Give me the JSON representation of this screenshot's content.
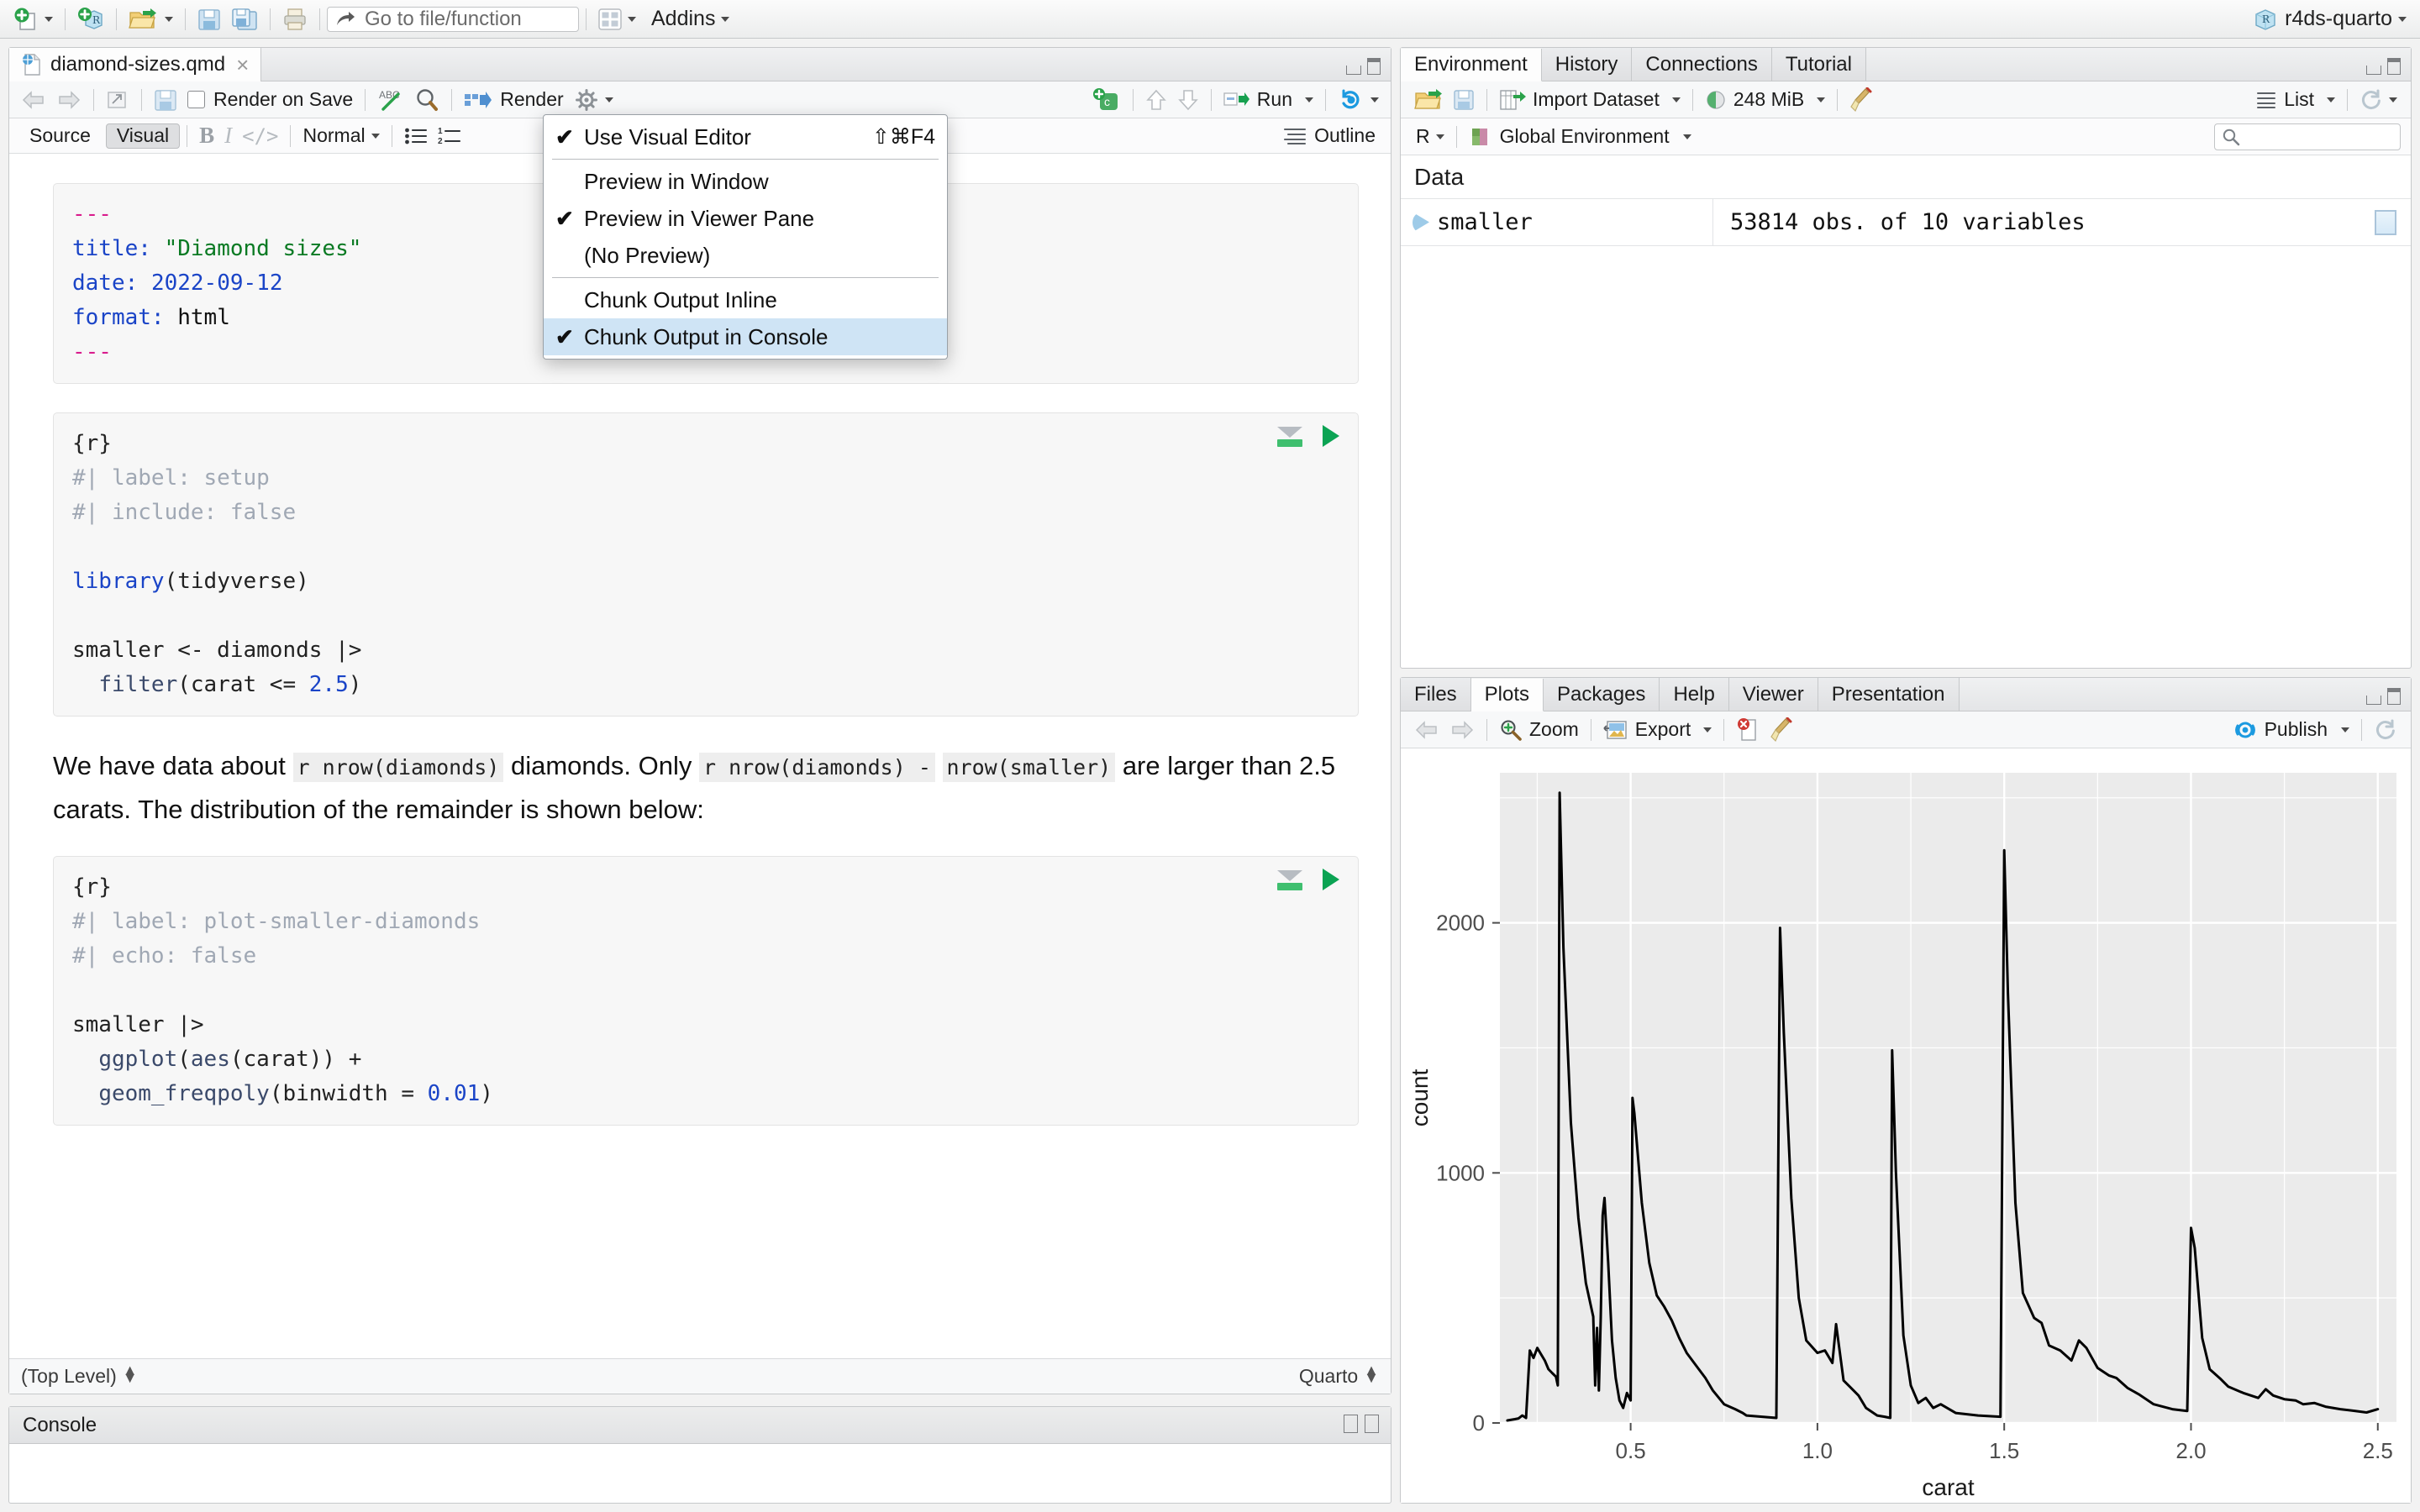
{
  "app": {
    "project_name": "r4ds-quarto",
    "goto_placeholder": "Go to file/function",
    "addins_label": "Addins"
  },
  "source_pane": {
    "tab_name": "diamond-sizes.qmd",
    "render_on_save_label": "Render on Save",
    "render_label": "Render",
    "run_label": "Run",
    "outline_label": "Outline",
    "mode_source": "Source",
    "mode_visual": "Visual",
    "block_format": "Normal",
    "status_left": "(Top Level)",
    "status_right": "Quarto"
  },
  "gear_menu": {
    "items": [
      {
        "label": "Use Visual Editor",
        "checked": true,
        "accel": "⇧⌘F4",
        "selected": false
      },
      {
        "label": "Preview in Window",
        "checked": false,
        "accel": "",
        "selected": false
      },
      {
        "label": "Preview in Viewer Pane",
        "checked": true,
        "accel": "",
        "selected": false
      },
      {
        "label": "(No Preview)",
        "checked": false,
        "accel": "",
        "selected": false
      },
      {
        "label": "Chunk Output Inline",
        "checked": false,
        "accel": "",
        "selected": false
      },
      {
        "label": "Chunk Output in Console",
        "checked": true,
        "accel": "",
        "selected": true
      }
    ],
    "separators_after": [
      0,
      3
    ]
  },
  "document": {
    "yaml": {
      "open_fence": "---",
      "close_fence": "---",
      "lines": [
        {
          "key": "title:",
          "value": "\"Diamond sizes\"",
          "kind": "string"
        },
        {
          "key": "date:",
          "value": "2022-09-12",
          "kind": "number"
        },
        {
          "key": "format:",
          "value": "html",
          "kind": "plain"
        }
      ]
    },
    "chunk1": {
      "header": "{r}",
      "options": [
        "#| label: setup",
        "#| include: false"
      ],
      "code_lines": [
        "library(tidyverse)",
        "",
        "smaller <- diamonds |>",
        "  filter(carat <= 2.5)"
      ]
    },
    "paragraph": {
      "seg1": "We have data about ",
      "code1": "r nrow(diamonds)",
      "seg2": " diamonds. Only ",
      "code2": "r nrow(diamonds) -",
      "code3": "nrow(smaller)",
      "seg3": " are larger than 2.5 carats. The distribution of the remainder is shown below:"
    },
    "chunk2": {
      "header": "{r}",
      "options": [
        "#| label: plot-smaller-diamonds",
        "#| echo: false"
      ],
      "code_lines": [
        "smaller |>",
        "  ggplot(aes(carat)) +",
        "  geom_freqpoly(binwidth = 0.01)"
      ]
    }
  },
  "environment_pane": {
    "tabs": [
      "Environment",
      "History",
      "Connections",
      "Tutorial"
    ],
    "active_tab": "Environment",
    "import_label": "Import Dataset",
    "memory_label": "248 MiB",
    "view_label": "List",
    "language": "R",
    "scope": "Global Environment",
    "search_placeholder": "",
    "section_title": "Data",
    "rows": [
      {
        "name": "smaller",
        "description": "53814 obs. of 10 variables"
      }
    ]
  },
  "plot_pane": {
    "tabs": [
      "Files",
      "Plots",
      "Packages",
      "Help",
      "Viewer",
      "Presentation"
    ],
    "active_tab": "Plots",
    "zoom_label": "Zoom",
    "export_label": "Export",
    "publish_label": "Publish"
  },
  "console_pane": {
    "title": "Console"
  },
  "chart_data": {
    "type": "line",
    "title": "",
    "xlabel": "carat",
    "ylabel": "count",
    "xlim": [
      0.15,
      2.55
    ],
    "ylim": [
      0,
      2600
    ],
    "xticks": [
      "0.5",
      "1.0",
      "1.5",
      "2.0",
      "2.5"
    ],
    "xtick_values": [
      0.5,
      1.0,
      1.5,
      2.0,
      2.5
    ],
    "yticks": [
      "0",
      "1000",
      "2000"
    ],
    "ytick_values": [
      0,
      1000,
      2000
    ],
    "grid": true,
    "panel_background": "#EBEBEB",
    "line_color": "#000000",
    "binwidth": 0.01,
    "series": [
      {
        "name": "count",
        "points": [
          [
            0.17,
            10
          ],
          [
            0.19,
            15
          ],
          [
            0.2,
            18
          ],
          [
            0.21,
            30
          ],
          [
            0.22,
            20
          ],
          [
            0.23,
            290
          ],
          [
            0.24,
            260
          ],
          [
            0.25,
            300
          ],
          [
            0.26,
            275
          ],
          [
            0.27,
            250
          ],
          [
            0.28,
            215
          ],
          [
            0.29,
            200
          ],
          [
            0.3,
            185
          ],
          [
            0.305,
            150
          ],
          [
            0.31,
            2520
          ],
          [
            0.32,
            1900
          ],
          [
            0.34,
            1200
          ],
          [
            0.36,
            820
          ],
          [
            0.38,
            560
          ],
          [
            0.4,
            425
          ],
          [
            0.405,
            150
          ],
          [
            0.41,
            380
          ],
          [
            0.415,
            130
          ],
          [
            0.42,
            420
          ],
          [
            0.425,
            830
          ],
          [
            0.43,
            900
          ],
          [
            0.44,
            640
          ],
          [
            0.45,
            330
          ],
          [
            0.46,
            180
          ],
          [
            0.47,
            90
          ],
          [
            0.48,
            60
          ],
          [
            0.49,
            120
          ],
          [
            0.5,
            90
          ],
          [
            0.505,
            1300
          ],
          [
            0.51,
            1240
          ],
          [
            0.53,
            880
          ],
          [
            0.55,
            640
          ],
          [
            0.57,
            510
          ],
          [
            0.59,
            465
          ],
          [
            0.61,
            410
          ],
          [
            0.63,
            340
          ],
          [
            0.65,
            280
          ],
          [
            0.68,
            220
          ],
          [
            0.7,
            180
          ],
          [
            0.72,
            130
          ],
          [
            0.75,
            75
          ],
          [
            0.78,
            55
          ],
          [
            0.8,
            40
          ],
          [
            0.81,
            30
          ],
          [
            0.89,
            20
          ],
          [
            0.9,
            1980
          ],
          [
            0.91,
            1560
          ],
          [
            0.93,
            900
          ],
          [
            0.95,
            500
          ],
          [
            0.97,
            330
          ],
          [
            1.0,
            280
          ],
          [
            1.02,
            290
          ],
          [
            1.04,
            240
          ],
          [
            1.05,
            395
          ],
          [
            1.07,
            170
          ],
          [
            1.09,
            140
          ],
          [
            1.11,
            110
          ],
          [
            1.13,
            60
          ],
          [
            1.16,
            30
          ],
          [
            1.18,
            25
          ],
          [
            1.195,
            20
          ],
          [
            1.2,
            1490
          ],
          [
            1.21,
            1000
          ],
          [
            1.23,
            350
          ],
          [
            1.25,
            150
          ],
          [
            1.27,
            80
          ],
          [
            1.29,
            100
          ],
          [
            1.31,
            60
          ],
          [
            1.33,
            75
          ],
          [
            1.37,
            40
          ],
          [
            1.43,
            30
          ],
          [
            1.49,
            25
          ],
          [
            1.5,
            2290
          ],
          [
            1.51,
            1720
          ],
          [
            1.53,
            880
          ],
          [
            1.55,
            520
          ],
          [
            1.58,
            420
          ],
          [
            1.6,
            400
          ],
          [
            1.62,
            310
          ],
          [
            1.65,
            290
          ],
          [
            1.68,
            250
          ],
          [
            1.7,
            330
          ],
          [
            1.72,
            300
          ],
          [
            1.75,
            220
          ],
          [
            1.78,
            190
          ],
          [
            1.8,
            180
          ],
          [
            1.83,
            140
          ],
          [
            1.86,
            115
          ],
          [
            1.9,
            75
          ],
          [
            1.95,
            55
          ],
          [
            1.99,
            48
          ],
          [
            2.0,
            780
          ],
          [
            2.01,
            700
          ],
          [
            2.03,
            340
          ],
          [
            2.05,
            215
          ],
          [
            2.08,
            175
          ],
          [
            2.1,
            145
          ],
          [
            2.14,
            120
          ],
          [
            2.18,
            100
          ],
          [
            2.2,
            135
          ],
          [
            2.22,
            110
          ],
          [
            2.25,
            95
          ],
          [
            2.28,
            90
          ],
          [
            2.3,
            75
          ],
          [
            2.33,
            80
          ],
          [
            2.36,
            65
          ],
          [
            2.4,
            55
          ],
          [
            2.44,
            48
          ],
          [
            2.47,
            42
          ],
          [
            2.5,
            55
          ]
        ]
      }
    ]
  }
}
